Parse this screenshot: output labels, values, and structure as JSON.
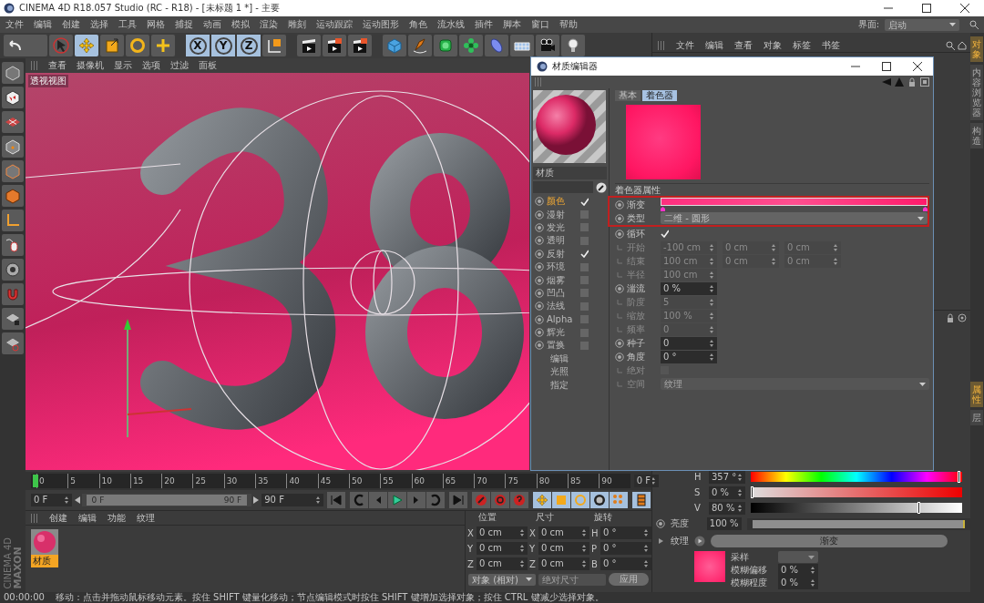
{
  "window": {
    "title": "CINEMA 4D R18.057 Studio (RC - R18) - [未标题 1 *] - 主要"
  },
  "menu": [
    "文件",
    "编辑",
    "创建",
    "选择",
    "工具",
    "网格",
    "捕捉",
    "动画",
    "模拟",
    "渲染",
    "雕刻",
    "运动跟踪",
    "运动图形",
    "角色",
    "流水线",
    "插件",
    "脚本",
    "窗口",
    "帮助"
  ],
  "layout_selector": {
    "label": "界面:",
    "value": "启动"
  },
  "toolbar": {
    "tools": [
      {
        "kind": "select",
        "selected": false
      },
      {
        "kind": "move",
        "selected": true
      },
      {
        "kind": "scale",
        "selected": false
      },
      {
        "kind": "rotate",
        "selected": false
      },
      {
        "kind": "add",
        "selected": false
      }
    ],
    "axes": [
      {
        "label": "X",
        "selected": true
      },
      {
        "label": "Y",
        "selected": true
      },
      {
        "label": "Z",
        "selected": true
      }
    ]
  },
  "viewport": {
    "menu": [
      "查看",
      "摄像机",
      "显示",
      "选项",
      "过滤",
      "面板"
    ],
    "label": "透视视图"
  },
  "timeline": {
    "ticks": [
      "0",
      "5",
      "10",
      "15",
      "20",
      "25",
      "30",
      "35",
      "40",
      "45",
      "50",
      "55",
      "60",
      "65",
      "70",
      "75",
      "80",
      "85",
      "90"
    ],
    "frame": "0 F"
  },
  "transport": {
    "start": "0 F",
    "range_start": "0 F",
    "range_end": "90 F",
    "end": "90 F",
    "range": {
      "level": 1
    }
  },
  "material_manager": {
    "menu": [
      "创建",
      "编辑",
      "功能",
      "纹理"
    ],
    "materials": [
      {
        "name": "材质",
        "selected": true
      }
    ]
  },
  "coordinates": {
    "headers": [
      "位置",
      "尺寸",
      "旋转"
    ],
    "rows": [
      {
        "axes": [
          "X",
          "X",
          "H"
        ],
        "values": [
          "0 cm",
          "0 cm",
          "0 °"
        ]
      },
      {
        "axes": [
          "Y",
          "Y",
          "P"
        ],
        "values": [
          "0 cm",
          "0 cm",
          "0 °"
        ]
      },
      {
        "axes": [
          "Z",
          "Z",
          "B"
        ],
        "values": [
          "0 cm",
          "0 cm",
          "0 °"
        ]
      }
    ],
    "mode": "对象 (相对)",
    "size_mode": "绝对尺寸",
    "apply": "应用"
  },
  "object_manager": {
    "menu": [
      "文件",
      "编辑",
      "查看",
      "对象",
      "标签",
      "书签"
    ]
  },
  "side_tabs_top": [
    {
      "label": "对象",
      "selected": true
    },
    {
      "label": "内容浏览器",
      "selected": false
    },
    {
      "label": "构造",
      "selected": false
    }
  ],
  "side_tabs_bottom": [
    {
      "label": "属性",
      "selected": true
    },
    {
      "label": "层",
      "selected": false
    }
  ],
  "attributes": {
    "hsv": [
      {
        "label": "H",
        "value": "357 °",
        "level": 0.99
      },
      {
        "label": "S",
        "value": "0 %",
        "level": 0
      },
      {
        "label": "V",
        "value": "80 %",
        "level": 0.8
      }
    ],
    "brightness": {
      "label": "亮度",
      "value": "100 %",
      "level": 1
    },
    "texture": {
      "label": "纹理",
      "shader": "渐变"
    },
    "sampling": {
      "label": "采样"
    },
    "blur_offset": {
      "label": "模糊偏移",
      "value": "0 %"
    },
    "blur_scale": {
      "label": "模糊程度",
      "value": "0 %"
    }
  },
  "material_editor": {
    "title": "材质编辑器",
    "name": "材质",
    "channels": [
      {
        "label": "颜色",
        "kind": "checkbox",
        "checked": true,
        "selected": true
      },
      {
        "label": "漫射",
        "kind": "checkbox",
        "checked": false,
        "selected": false
      },
      {
        "label": "发光",
        "kind": "checkbox",
        "checked": false,
        "selected": false
      },
      {
        "label": "透明",
        "kind": "checkbox",
        "checked": false,
        "selected": false
      },
      {
        "label": "反射",
        "kind": "checkbox",
        "checked": true,
        "selected": false
      },
      {
        "label": "环境",
        "kind": "checkbox",
        "checked": false,
        "selected": false
      },
      {
        "label": "烟雾",
        "kind": "checkbox",
        "checked": false,
        "selected": false
      },
      {
        "label": "凹凸",
        "kind": "checkbox",
        "checked": false,
        "selected": false
      },
      {
        "label": "法线",
        "kind": "checkbox",
        "checked": false,
        "selected": false
      },
      {
        "label": "Alpha",
        "kind": "checkbox",
        "checked": false,
        "selected": false
      },
      {
        "label": "辉光",
        "kind": "checkbox",
        "checked": false,
        "selected": false
      },
      {
        "label": "置换",
        "kind": "checkbox",
        "checked": false,
        "selected": false
      },
      {
        "label": "编辑",
        "kind": "plain",
        "selected": false
      },
      {
        "label": "光照",
        "kind": "plain",
        "selected": false
      },
      {
        "label": "指定",
        "kind": "plain",
        "selected": false
      }
    ],
    "tabs": [
      {
        "label": "基本",
        "selected": false
      },
      {
        "label": "着色器",
        "selected": true
      }
    ],
    "section": "着色器属性",
    "params": [
      {
        "kind": "gradient",
        "label": "渐变",
        "highlighted": true,
        "disabled": false
      },
      {
        "kind": "dropdown",
        "label": "类型",
        "value": "二维 - 圆形",
        "highlighted": true,
        "disabled": false
      },
      {
        "kind": "check",
        "label": "循环",
        "checked": true,
        "disabled": false
      },
      {
        "kind": "vector",
        "label": "开始",
        "values": [
          "-100 cm",
          "0 cm",
          "0 cm"
        ],
        "disabled": true
      },
      {
        "kind": "vector",
        "label": "结束",
        "values": [
          "100 cm",
          "0 cm",
          "0 cm"
        ],
        "disabled": true
      },
      {
        "kind": "number",
        "label": "半径",
        "value": "100 cm",
        "disabled": true
      },
      {
        "kind": "number",
        "label": "湍流",
        "value": "0 %",
        "disabled": false
      },
      {
        "kind": "number",
        "label": "阶度",
        "value": "5",
        "disabled": true
      },
      {
        "kind": "number",
        "label": "缩放",
        "value": "100 %",
        "disabled": true
      },
      {
        "kind": "number",
        "label": "频率",
        "value": "0",
        "disabled": true
      },
      {
        "kind": "number",
        "label": "种子",
        "value": "0",
        "disabled": false
      },
      {
        "kind": "number",
        "label": "角度",
        "value": "0 °",
        "disabled": false
      },
      {
        "kind": "check",
        "label": "绝对",
        "checked": false,
        "disabled": true
      },
      {
        "kind": "dropdown",
        "label": "空间",
        "value": "纹理",
        "disabled": true
      }
    ]
  },
  "logo": {
    "brand": "MAXON",
    "product": "CINEMA 4D"
  },
  "status_bar": {
    "time": "00:00:00",
    "message": "移动：点击并拖动鼠标移动元素。按住 SHIFT 键量化移动；节点编辑模式时按住 SHIFT 键增加选择对象；按住 CTRL 键减少选择对象。"
  }
}
